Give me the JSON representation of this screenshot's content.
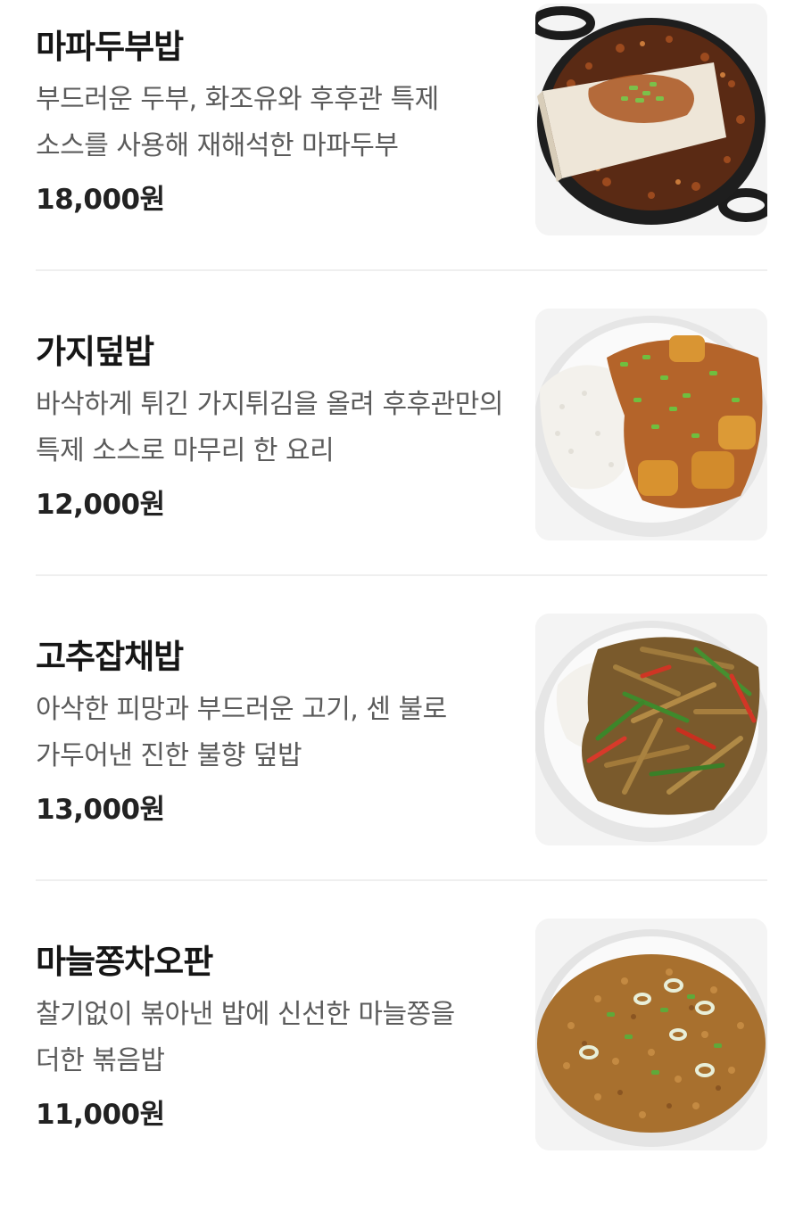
{
  "menu": {
    "items": [
      {
        "name": "마파두부밥",
        "description": "부드러운 두부, 화조유와 후후관 특제 소스를 사용해 재해석한 마파두부",
        "price": "18,000원",
        "photo_icon": "mapo-tofu-skillet"
      },
      {
        "name": "가지덮밥",
        "description": "바삭하게 튀긴 가지튀김을 올려 후후관만의 특제 소스로 마무리 한 요리",
        "price": "12,000원",
        "photo_icon": "eggplant-rice-plate"
      },
      {
        "name": "고추잡채밥",
        "description": "아삭한 피망과 부드러운 고기, 센 불로 가두어낸 진한 불향 덮밥",
        "price": "13,000원",
        "photo_icon": "pepper-japchae-rice-plate"
      },
      {
        "name": "마늘쫑차오판",
        "description": "찰기없이 볶아낸 밥에 신선한 마늘쫑을 더한 볶음밥",
        "price": "11,000원",
        "photo_icon": "garlic-scape-fried-rice-plate"
      }
    ]
  },
  "colors": {
    "name_text": "#161616",
    "desc_text": "#5b5b5b",
    "price_text": "#222222",
    "divider": "#efefef"
  }
}
